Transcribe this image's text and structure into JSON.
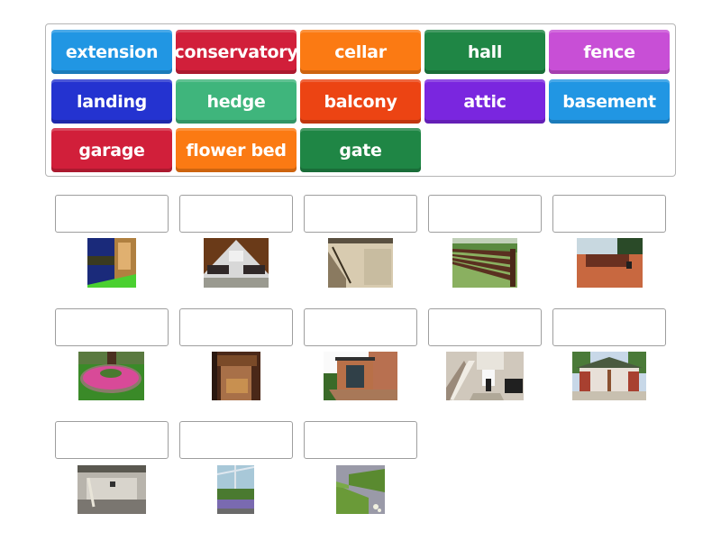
{
  "word_bank": {
    "tiles": [
      {
        "label": "extension",
        "color": "#2196e3"
      },
      {
        "label": "conservatory",
        "color": "#d11f3a"
      },
      {
        "label": "cellar",
        "color": "#fb7a13"
      },
      {
        "label": "hall",
        "color": "#1f8645"
      },
      {
        "label": "fence",
        "color": "#c84fd6"
      },
      {
        "label": "landing",
        "color": "#2433d0"
      },
      {
        "label": "hedge",
        "color": "#3fb57c"
      },
      {
        "label": "balcony",
        "color": "#ec4413"
      },
      {
        "label": "attic",
        "color": "#7a26df"
      },
      {
        "label": "basement",
        "color": "#2196e3"
      },
      {
        "label": "garage",
        "color": "#d11f3a"
      },
      {
        "label": "flower bed",
        "color": "#fb7a13"
      },
      {
        "label": "gate",
        "color": "#1f8645"
      }
    ]
  },
  "targets": [
    {
      "image": "balcony-photo",
      "answer": ""
    },
    {
      "image": "attic-photo",
      "answer": ""
    },
    {
      "image": "landing-photo",
      "answer": ""
    },
    {
      "image": "fence-photo",
      "answer": ""
    },
    {
      "image": "gate-photo",
      "answer": ""
    },
    {
      "image": "flower-bed-photo",
      "answer": ""
    },
    {
      "image": "cellar-photo",
      "answer": ""
    },
    {
      "image": "extension-photo",
      "answer": ""
    },
    {
      "image": "hall-photo",
      "answer": ""
    },
    {
      "image": "garage-photo",
      "answer": ""
    },
    {
      "image": "basement-photo",
      "answer": ""
    },
    {
      "image": "conservatory-photo",
      "answer": ""
    },
    {
      "image": "hedge-photo",
      "answer": ""
    }
  ]
}
